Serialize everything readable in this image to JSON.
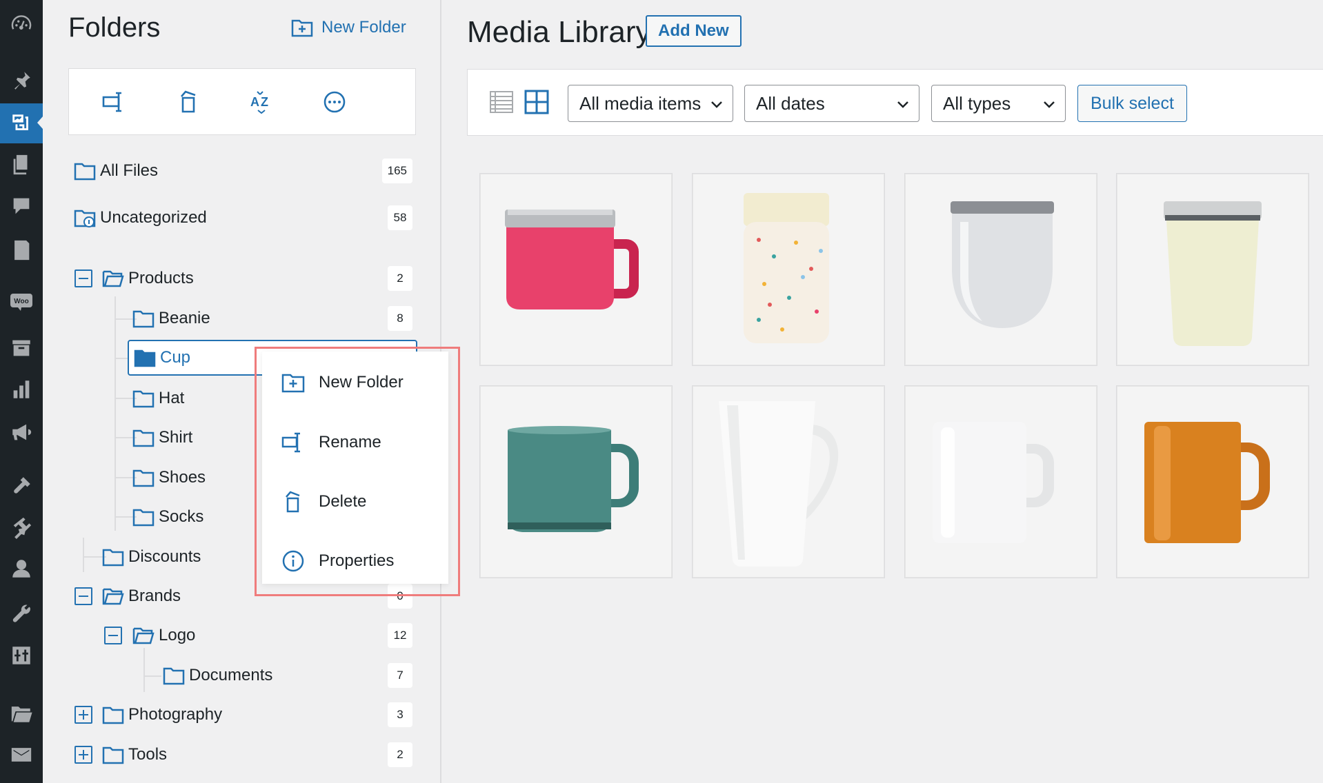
{
  "admin_menu": [
    {
      "icon": "dashboard-icon"
    },
    {
      "icon": "pin-icon"
    },
    {
      "icon": "media-icon",
      "active": true
    },
    {
      "icon": "pages-icon"
    },
    {
      "icon": "comments-icon"
    },
    {
      "icon": "forms-icon"
    },
    {
      "icon": "woo-icon",
      "label": "Woo"
    },
    {
      "icon": "archive-icon"
    },
    {
      "icon": "analytics-icon"
    },
    {
      "icon": "marketing-icon"
    },
    {
      "icon": "appearance-icon"
    },
    {
      "icon": "plugins-icon"
    },
    {
      "icon": "users-icon"
    },
    {
      "icon": "tools-icon"
    },
    {
      "icon": "settings-icon"
    },
    {
      "icon": "folder-icon"
    },
    {
      "icon": "mail-icon"
    }
  ],
  "folders": {
    "title": "Folders",
    "new_folder_label": "New Folder",
    "toolbar_icons": [
      "rename-icon",
      "delete-icon",
      "sort-az-icon",
      "more-icon"
    ],
    "all_files": {
      "label": "All Files",
      "count": "165"
    },
    "uncategorized": {
      "label": "Uncategorized",
      "count": "58"
    },
    "tree": {
      "products": {
        "label": "Products",
        "count": "2"
      },
      "beanie": {
        "label": "Beanie",
        "count": "8"
      },
      "cup": {
        "label": "Cup"
      },
      "hat": {
        "label": "Hat"
      },
      "shirt": {
        "label": "Shirt"
      },
      "shoes": {
        "label": "Shoes"
      },
      "socks": {
        "label": "Socks"
      },
      "discounts": {
        "label": "Discounts"
      },
      "brands": {
        "label": "Brands",
        "count": "0"
      },
      "logo": {
        "label": "Logo",
        "count": "12"
      },
      "documents": {
        "label": "Documents",
        "count": "7"
      },
      "photography": {
        "label": "Photography",
        "count": "3"
      },
      "tools": {
        "label": "Tools",
        "count": "2"
      }
    }
  },
  "context_menu": {
    "new_folder": "New Folder",
    "rename": "Rename",
    "delete": "Delete",
    "properties": "Properties"
  },
  "main": {
    "title": "Media Library",
    "add_new": "Add New",
    "filters": {
      "media_items": "All media items",
      "dates": "All dates",
      "types": "All types"
    },
    "bulk_select": "Bulk select",
    "view_modes": [
      "list-view-icon",
      "grid-view-icon"
    ],
    "selected_view": "grid",
    "media": [
      {
        "kind": "pink-camp-mug"
      },
      {
        "kind": "terrazzo-tumbler"
      },
      {
        "kind": "white-stemless-tumbler"
      },
      {
        "kind": "cream-tumbler"
      },
      {
        "kind": "teal-enamel-mug"
      },
      {
        "kind": "white-latte-mug"
      },
      {
        "kind": "white-mug"
      },
      {
        "kind": "orange-mug"
      }
    ]
  },
  "colors": {
    "accent": "#2271b1",
    "admin_bg": "#1d2327",
    "highlight_outline": "#ef7c7c"
  }
}
